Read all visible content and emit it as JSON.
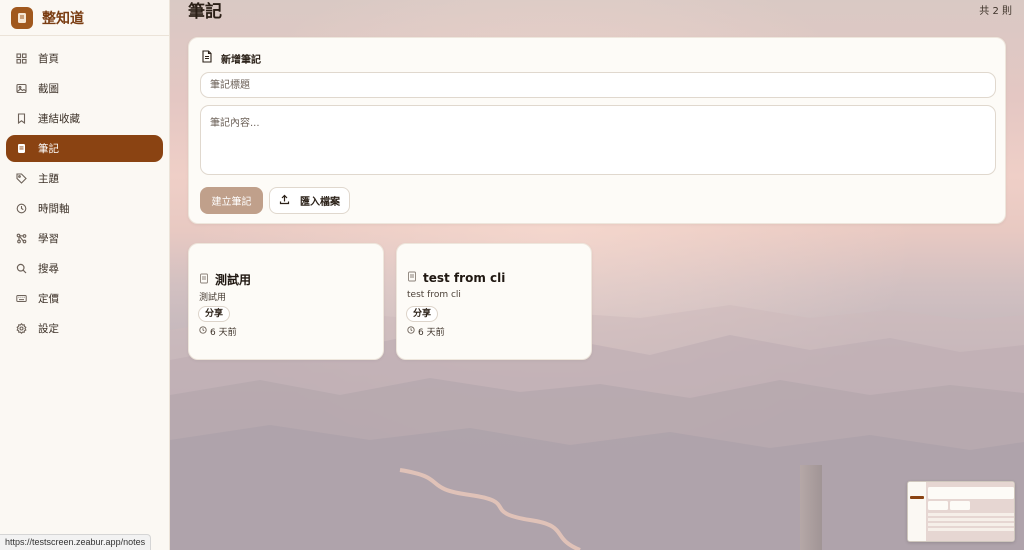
{
  "brand": {
    "title": "整知道"
  },
  "nav": [
    {
      "label": "首頁",
      "icon": "grid-icon"
    },
    {
      "label": "截圖",
      "icon": "image-icon"
    },
    {
      "label": "連結收藏",
      "icon": "bookmark-icon"
    },
    {
      "label": "筆記",
      "icon": "note-icon",
      "active": true
    },
    {
      "label": "主題",
      "icon": "tag-icon"
    },
    {
      "label": "時間軸",
      "icon": "clock-icon"
    },
    {
      "label": "學習",
      "icon": "network-icon"
    },
    {
      "label": "搜尋",
      "icon": "search-icon"
    },
    {
      "label": "定價",
      "icon": "keyboard-icon"
    },
    {
      "label": "設定",
      "icon": "gear-icon"
    }
  ],
  "page": {
    "title": "筆記",
    "count": "共 2 則"
  },
  "new_note": {
    "heading": "新增筆記",
    "title_placeholder": "筆記標題",
    "content_placeholder": "筆記內容...",
    "create_label": "建立筆記",
    "import_label": "匯入檔案"
  },
  "notes": [
    {
      "title": "測試用",
      "body": "測試用",
      "share_label": "分享",
      "time": "6 天前"
    },
    {
      "title": "test from cli",
      "body": "test from cli",
      "share_label": "分享",
      "time": "6 天前"
    }
  ],
  "status": {
    "url": "https://testscreen.zeabur.app/notes"
  },
  "colors": {
    "accent": "#8a4312",
    "brand": "#7a3d12",
    "create_button": "#c0a08b"
  }
}
